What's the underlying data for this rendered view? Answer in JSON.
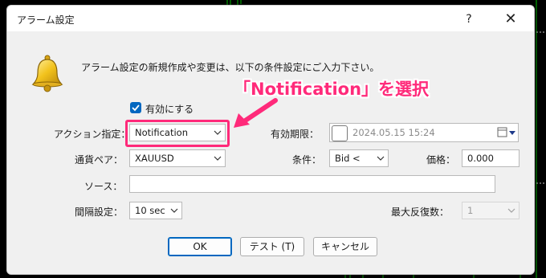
{
  "dialog": {
    "title": "アラーム設定",
    "help_label": "?",
    "close_label": "✕"
  },
  "intro_text": "アラーム設定の新規作成や変更は、以下の条件設定にご入力下さい。",
  "enabled": {
    "label": "有効にする",
    "checked": true
  },
  "action": {
    "label": "アクション指定：",
    "value": "Notification"
  },
  "expiry": {
    "label": "有効期限：",
    "value": "2024.05.15 15:24",
    "checked": false
  },
  "symbol": {
    "label": "通貨ペア：",
    "value": "XAUUSD"
  },
  "condition": {
    "label": "条件：",
    "value": "Bid <"
  },
  "price": {
    "label": "価格：",
    "value": "0.000"
  },
  "source": {
    "label": "ソース：",
    "value": ""
  },
  "interval": {
    "label": "間隔設定：",
    "value": "10 sec"
  },
  "max_repeats": {
    "label": "最大反復数：",
    "value": "1"
  },
  "buttons": {
    "ok": "OK",
    "test": "テスト (T)",
    "cancel": "キャンセル"
  },
  "annotation": {
    "text": "「Notification」を選択",
    "color": "#ff2a7a"
  },
  "colors": {
    "accent": "#0067c0",
    "highlight": "#ff2a7a"
  }
}
